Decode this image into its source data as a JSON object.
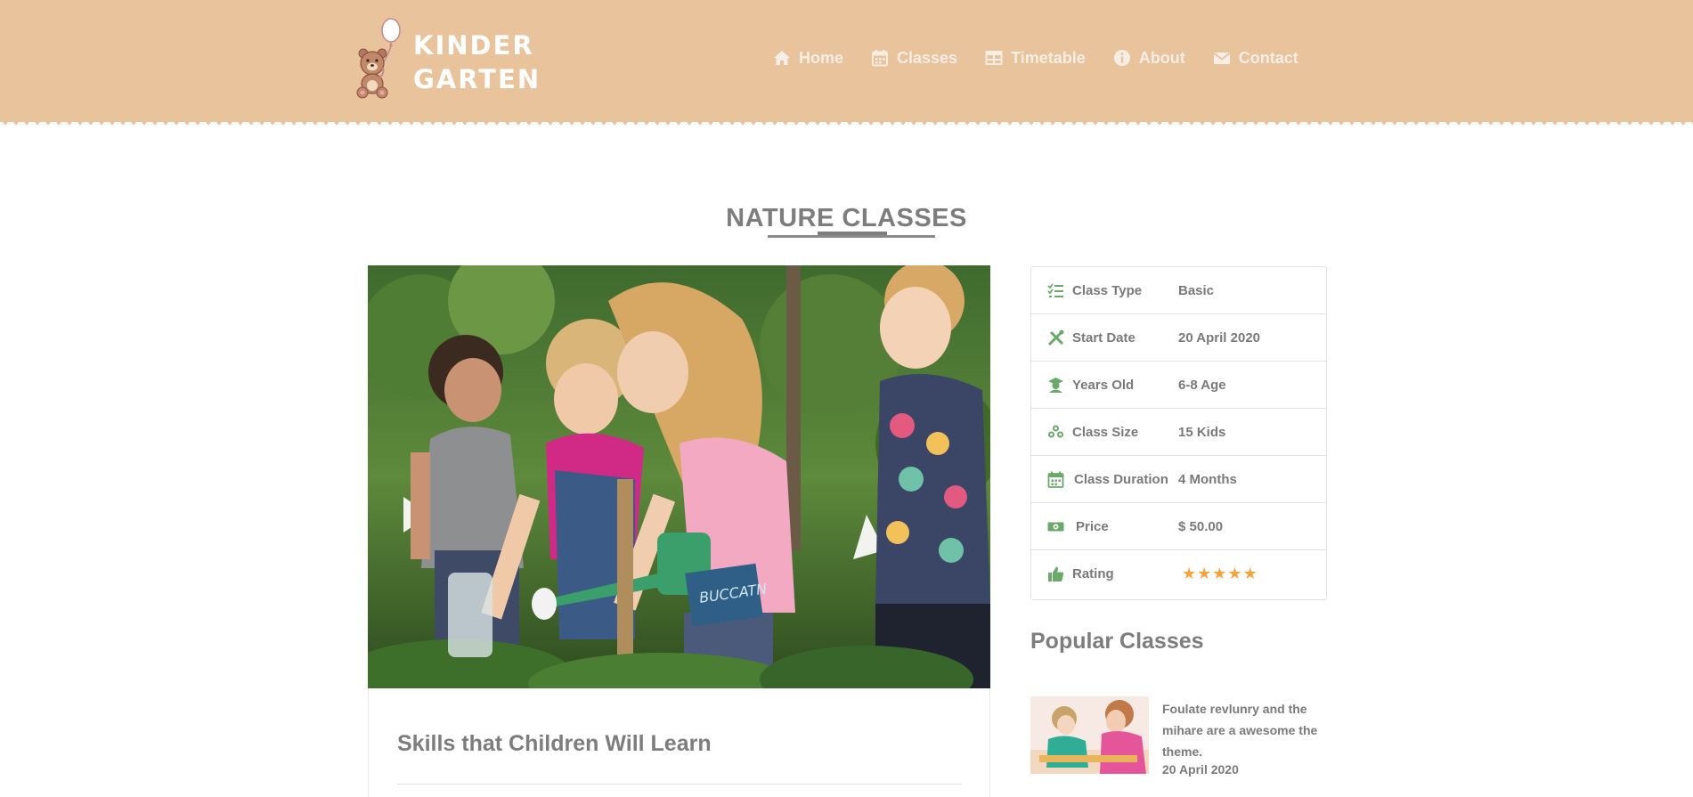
{
  "brand": {
    "line1": "KINDER",
    "line2": "GARTEN"
  },
  "nav": {
    "home": "Home",
    "classes": "Classes",
    "timetable": "Timetable",
    "about": "About",
    "contact": "Contact"
  },
  "page": {
    "title": "NATURE CLASSES"
  },
  "main": {
    "photo_alt": "Children gardening outdoors",
    "card_title": "Skills that Children Will Learn"
  },
  "info": {
    "rows": [
      {
        "label": "Class Type",
        "value": "Basic",
        "icon": "checklist-icon"
      },
      {
        "label": "Start Date",
        "value": "20 April 2020",
        "icon": "tools-icon"
      },
      {
        "label": "Years Old",
        "value": "6-8 Age",
        "icon": "graduate-icon"
      },
      {
        "label": "Class Size",
        "value": "15 Kids",
        "icon": "users-icon"
      },
      {
        "label": "Class Duration",
        "value": "4 Months",
        "icon": "calendar-icon"
      },
      {
        "label": "Price",
        "value": "$ 50.00",
        "icon": "money-icon"
      },
      {
        "label": "Rating",
        "icon": "thumbs-up-icon"
      }
    ],
    "rating_stars": 5
  },
  "popular": {
    "title": "Popular Classes",
    "items": [
      {
        "text": "Foulate revlunry and the mihare are a awesome the theme.",
        "date": "20 April 2020"
      }
    ]
  },
  "colors": {
    "header_bg": "#e9c39c",
    "accent_green": "#6aa96a",
    "star": "#f6a33b",
    "text": "#7a7a7a"
  }
}
